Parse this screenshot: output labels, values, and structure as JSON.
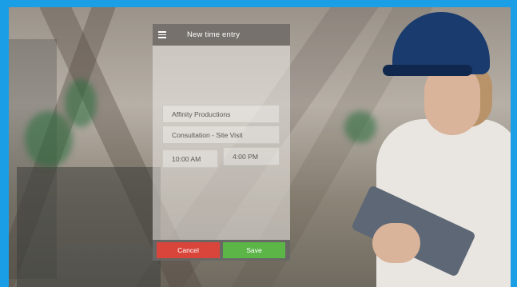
{
  "header": {
    "title": "New time entry",
    "menu_icon": "hamburger-icon"
  },
  "form": {
    "client": "Affinity Productions",
    "activity": "Consultation - Site Visit",
    "start_time": "10:00 AM",
    "end_time": "4:00 PM"
  },
  "footer": {
    "cancel_label": "Cancel",
    "save_label": "Save"
  },
  "colors": {
    "frame": "#1a9fe6",
    "cancel": "#d9453b",
    "save": "#5bb647",
    "header": "#76716c"
  }
}
